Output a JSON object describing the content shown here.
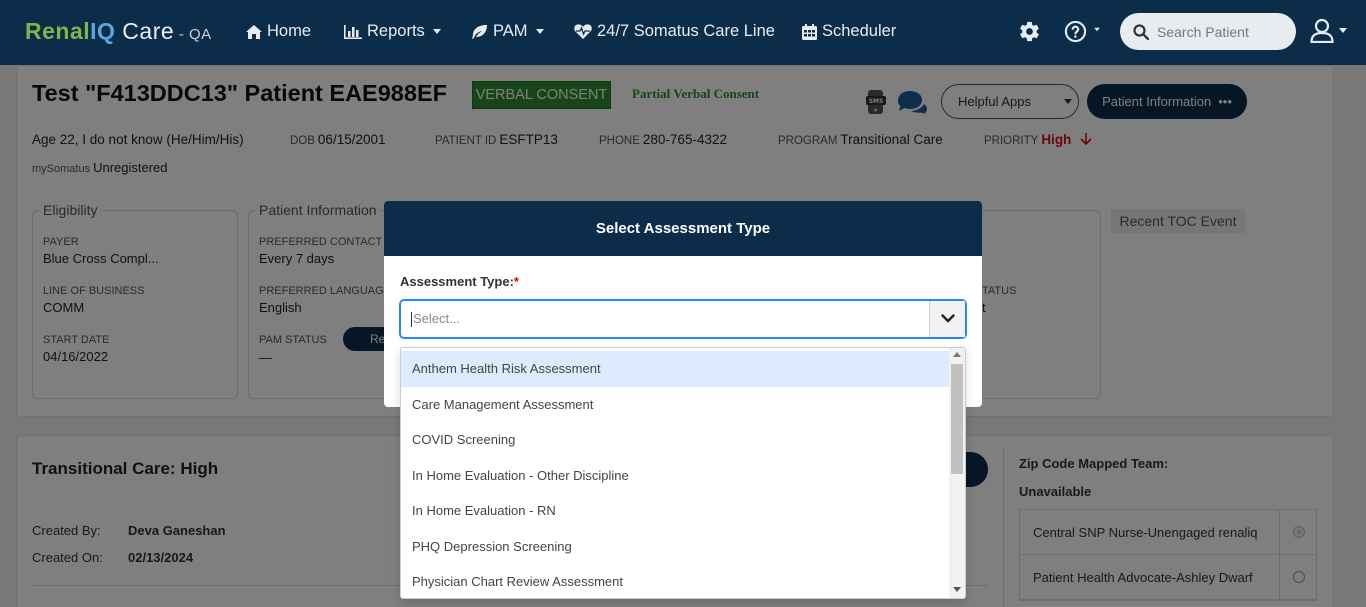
{
  "brand": {
    "part1": "Renal",
    "part2": "IQ",
    "part3": " Care",
    "part4": " - QA"
  },
  "nav": {
    "home": "Home",
    "reports": "Reports",
    "pam": "PAM",
    "careline": "24/7 Somatus Care Line",
    "scheduler": "Scheduler",
    "search_placeholder": "Search Patient"
  },
  "patient": {
    "title": "Test \"F413DDC13\" Patient EAE988EF",
    "consent": "VERBAL CONSENT",
    "partial_consent": "Partial Verbal Consent",
    "helpful_apps": "Helpful Apps",
    "patient_information_btn": "Patient Information",
    "more": "•••",
    "age_pronouns": "Age 22, I do not know (He/Him/His)",
    "dob_label": "DOB",
    "dob": "06/15/2001",
    "patient_id_label": "PATIENT ID",
    "patient_id": "ESFTP13",
    "phone_label": "PHONE",
    "phone": "280-765-4322",
    "program_label": "PROGRAM",
    "program": "Transitional Care",
    "priority_label": "PRIORITY",
    "priority": "High",
    "mysomatus_label": "mySomatus",
    "mysomatus": "Unregistered"
  },
  "eligibility": {
    "title": "Eligibility",
    "payer_label": "PAYER",
    "payer": "Blue Cross Compl...",
    "lob_label": "LINE OF BUSINESS",
    "lob": "COMM",
    "start_label": "START DATE",
    "start": "04/16/2022"
  },
  "patient_info": {
    "title": "Patient Information",
    "contact_label": "PREFERRED CONTACT S",
    "contact": "Every 7 days",
    "language_label": "PREFERRED LANGUAGE",
    "language": "English",
    "pam_label": "PAM STATUS",
    "pam": "—",
    "pam_btn": "Re"
  },
  "partial_box": {
    "label": "TATUS",
    "value": "t"
  },
  "recent_toc": "Recent TOC Event",
  "transitional": {
    "title": "Transitional Care: High",
    "created_by_label": "Created By:",
    "created_by": "Deva Ganeshan",
    "created_on_label": "Created On:",
    "created_on": "02/13/2024",
    "btn_partial": "t"
  },
  "zip": {
    "label": "Zip Code Mapped Team:",
    "value": "Unavailable",
    "teams": [
      {
        "name": "Central SNP Nurse-Unengaged renaliq",
        "selected": true
      },
      {
        "name": "Patient Health Advocate-Ashley Dwarf",
        "selected": false
      }
    ]
  },
  "modal": {
    "title": "Select Assessment Type",
    "label": "Assessment Type:",
    "required": "*",
    "placeholder": "Select...",
    "options": [
      "Anthem Health Risk Assessment",
      "Care Management Assessment",
      "COVID Screening",
      "In Home Evaluation - Other Discipline",
      "In Home Evaluation - RN",
      "PHQ Depression Screening",
      "Physician Chart Review Assessment"
    ]
  }
}
